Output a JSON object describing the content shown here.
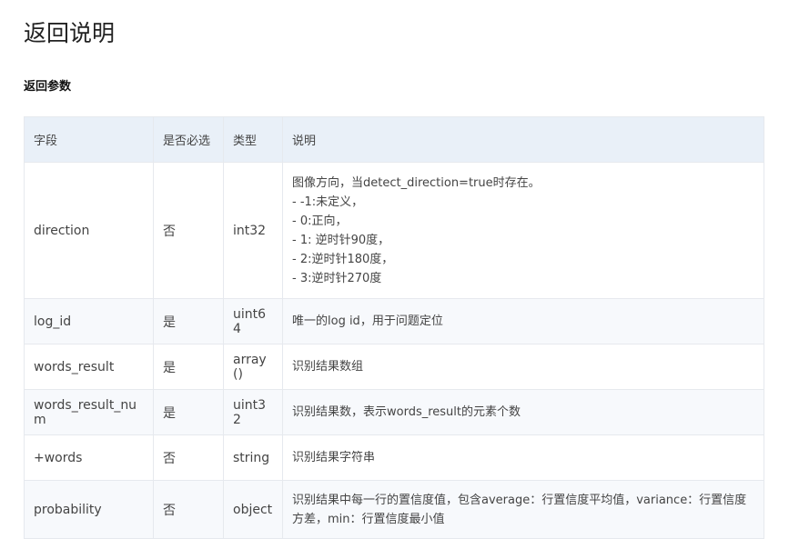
{
  "page": {
    "title": "返回说明",
    "section_title": "返回参数"
  },
  "table": {
    "headers": [
      "字段",
      "是否必选",
      "类型",
      "说明"
    ],
    "rows": [
      {
        "field": "direction",
        "required": "否",
        "type": "int32",
        "desc_lines": [
          "图像方向，当detect_direction=true时存在。",
          "- -1:未定义，",
          "- 0:正向，",
          "- 1: 逆时针90度，",
          "- 2:逆时针180度，",
          "- 3:逆时针270度"
        ]
      },
      {
        "field": "log_id",
        "required": "是",
        "type": "uint64",
        "desc_lines": [
          "唯一的log id，用于问题定位"
        ]
      },
      {
        "field": "words_result",
        "required": "是",
        "type": "array()",
        "desc_lines": [
          "识别结果数组"
        ]
      },
      {
        "field": "words_result_num",
        "required": "是",
        "type": "uint32",
        "desc_lines": [
          "识别结果数，表示words_result的元素个数"
        ]
      },
      {
        "field": "+words",
        "required": "否",
        "type": "string",
        "desc_lines": [
          "识别结果字符串"
        ]
      },
      {
        "field": "probability",
        "required": "否",
        "type": "object",
        "desc_lines": [
          "识别结果中每一行的置信度值，包含average：行置信度平均值，variance：行置信度方差，min：行置信度最小值"
        ]
      }
    ]
  }
}
